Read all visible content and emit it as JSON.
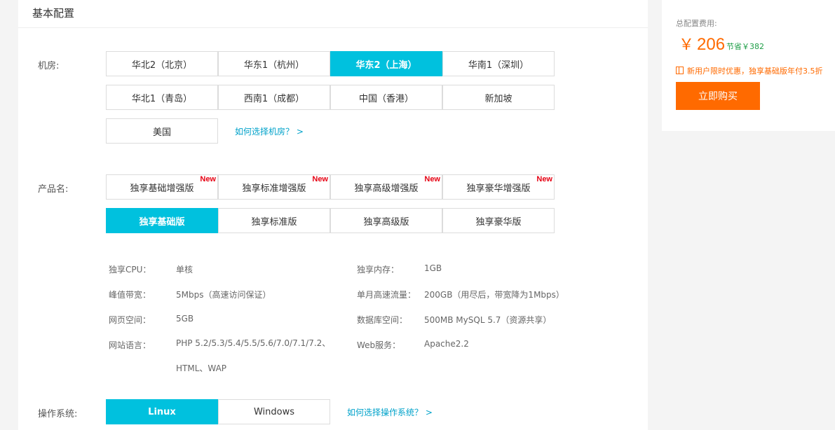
{
  "section": {
    "title": "基本配置"
  },
  "datacenter": {
    "label": "机房:",
    "options": [
      "华北2（北京）",
      "华东1（杭州）",
      "华东2（上海）",
      "华南1（深圳）",
      "华北1（青岛）",
      "西南1（成都）",
      "中国（香港）",
      "新加坡",
      "美国"
    ],
    "selected": "华东2（上海）",
    "help_link": "如何选择机房？ >"
  },
  "product": {
    "label": "产品名:",
    "new_badge": "New",
    "enhanced_options": [
      "独享基础增强版",
      "独享标准增强版",
      "独享高级增强版",
      "独享豪华增强版"
    ],
    "standard_options": [
      "独享基础版",
      "独享标准版",
      "独享高级版",
      "独享豪华版"
    ],
    "selected": "独享基础版"
  },
  "specs": {
    "cpu_label": "独享CPU：",
    "cpu_value": "单核",
    "memory_label": "独享内存：",
    "memory_value": "1GB",
    "bandwidth_label": "峰值带宽：",
    "bandwidth_value": "5Mbps（高速访问保证）",
    "traffic_label": "单月高速流量：",
    "traffic_value": "200GB（用尽后，带宽降为1Mbps）",
    "web_space_label": "网页空间：",
    "web_space_value": "5GB",
    "db_space_label": "数据库空间：",
    "db_space_value": "500MB MySQL 5.7（资源共享）",
    "languages_label": "网站语言：",
    "languages_value": "PHP 5.2/5.3/5.4/5.5/5.6/7.0/7.1/7.2、HTML、WAP",
    "web_service_label": "Web服务：",
    "web_service_value": "Apache2.2"
  },
  "os": {
    "label": "操作系统:",
    "options": [
      "Linux",
      "Windows"
    ],
    "selected": "Linux",
    "help_link": "如何选择操作系统？ >"
  },
  "summary": {
    "cost_label": "总配置费用:",
    "currency": "￥",
    "price": "206",
    "savings": "节省￥382",
    "promo": "新用户限时优惠，独享基础版年付3.5折",
    "buy_button": "立即购买"
  },
  "colors": {
    "accent": "#00c1de",
    "price": "#ff6a00",
    "save": "#1e9e47",
    "link": "#00a2ca",
    "badge": "#e60012"
  }
}
